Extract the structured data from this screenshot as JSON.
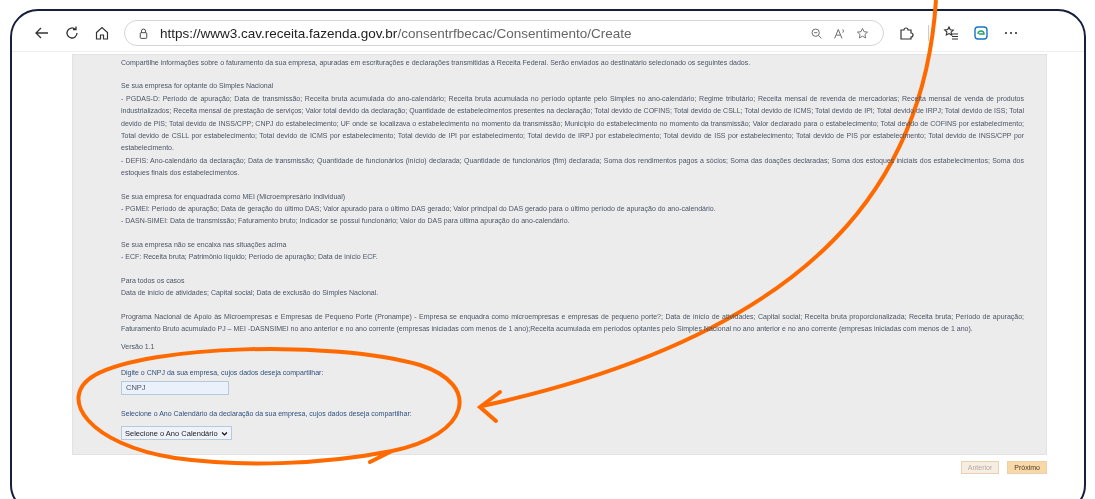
{
  "browser": {
    "url_host": "https://www3.cav.receita.fazenda.gov.br",
    "url_path": "/consentrfbecac/Consentimento/Create"
  },
  "page": {
    "intro": "Compartilhe informações sobre o faturamento da sua empresa, apuradas em escriturações e declarações transmitidas à Receita Federal. Serão enviados ao destinatário selecionado os seguintes dados.",
    "sections": [
      {
        "heading": "Se sua empresa for optante do Simples Nacional",
        "items": [
          "- PGDAS-D: Período de apuração; Data de transmissão; Receita bruta acumulada do ano-calendário; Receita bruta acumulada no período optante pelo Simples no ano-calendário; Regime tributário; Receita mensal de revenda de mercadorias; Receita mensal de venda de produtos industrializados; Receita mensal de prestação de serviços; Valor total devido da declaração; Quantidade de estabelecimentos presentes na declaração; Total devido de COFINS; Total devido de CSLL; Total devido de ICMS; Total devido de IPI; Total devido de IRPJ; Total devido de ISS; Total devido de PIS; Total devido de INSS/CPP; CNPJ do estabelecimento; UF onde se localizava o estabelecimento no momento da transmissão; Município do estabelecimento no momento da transmissão; Valor declarado para o estabelecimento; Total devido de COFINS por estabelecimento; Total devido de CSLL por estabelecimento; Total devido de ICMS por estabelecimento; Total devido de IPI por estabelecimento; Total devido de IRPJ por estabelecimento; Total devido de ISS por estabelecimento; Total devido de PIS por estabelecimento; Total devido de INSS/CPP por estabelecimento.",
          "- DEFIS: Ano-calendário da declaração; Data de transmissão; Quantidade de funcionários (início) declarada; Quantidade de funcionários (fim) declarada; Soma dos rendimentos pagos a sócios; Soma das doações declaradas; Soma dos estoques iniciais dos estabelecimentos; Soma dos estoques finais dos estabelecimentos."
        ]
      },
      {
        "heading": "Se sua empresa for enquadrada como MEI (Microempresário Individual)",
        "items": [
          "- PGMEI: Período de apuração; Data de geração do último DAS; Valor apurado para o último DAS gerado; Valor principal do DAS gerado para o último período de apuração do ano-calendário.",
          "- DASN-SIMEI: Data de transmissão; Faturamento bruto; Indicador se possui funcionário; Valor do DAS para última apuração do ano-calendário."
        ]
      },
      {
        "heading": "Se sua empresa não se encaixa nas situações acima",
        "items": [
          "- ECF: Receita bruta; Patrimônio líquido; Período de apuração; Data de início ECF."
        ]
      },
      {
        "heading": "Para todos os casos",
        "items": [
          "Data de início de atividades; Capital social; Data de exclusão do Simples Nacional."
        ]
      },
      {
        "items": [
          "Programa Nacional de Apoio às Microempresas e Empresas de Pequeno Porte (Pronampe) - Empresa se enquadra como microempresas e empresas de pequeno porte?; Data de início de atividades; Capital social; Receita bruta proporcionalizada; Receita bruta; Período de apuração; Faturamento Bruto acumulado PJ – MEI -DASNSIMEI no ano anterior e no ano corrente (empresas iniciadas com menos de 1 ano);Receita acumulada em períodos optantes pelo Simples Nacional no ano anterior e no ano corrente (empresas iniciadas com menos de 1 ano)."
        ]
      }
    ],
    "version": "Versão 1.1",
    "cnpj_label": "Digite o CNPJ da sua empresa, cujos dados deseja compartilhar:",
    "cnpj_field": {
      "placeholder": "CNPJ"
    },
    "year_label": "Selecione o Ano Calendário da declaração da sua empresa, cujos dados deseja compartilhar:",
    "year_select": {
      "value": "Selecione o Ano Calendário"
    }
  },
  "buttons": [
    {
      "label": "Anterior",
      "disabled": true
    },
    {
      "label": "Próximo",
      "disabled": false
    }
  ]
}
